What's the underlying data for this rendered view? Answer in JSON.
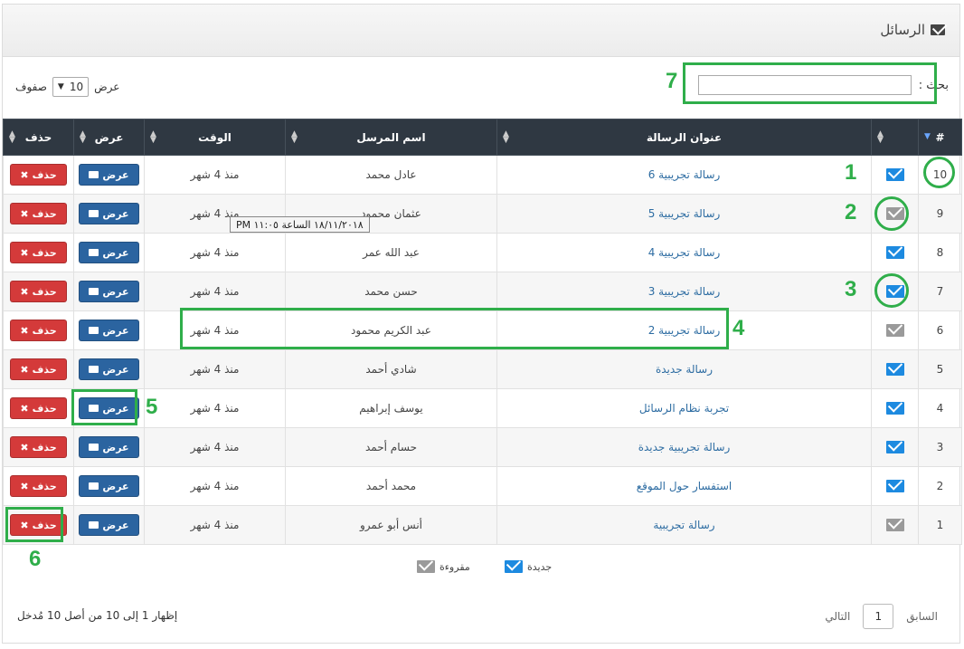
{
  "panel": {
    "title": "الرسائل",
    "icon": "envelope-icon"
  },
  "search": {
    "label": "بحث :",
    "value": ""
  },
  "length": {
    "before": "عرض",
    "value": "10",
    "after": "صفوف"
  },
  "table": {
    "columns": [
      "#",
      "",
      "عنوان الرسالة",
      "اسم المرسل",
      "الوقت",
      "عرض",
      "حذف"
    ],
    "view_label": "عرض",
    "delete_label": "حذف",
    "rows": [
      {
        "id": "10",
        "status": "new",
        "subject": "رسالة تجريبية 6",
        "sender": "عادل محمد",
        "time": "منذ 4 شهر"
      },
      {
        "id": "9",
        "status": "read",
        "subject": "رسالة تجريبية 5",
        "sender": "عثمان محمود",
        "time": "منذ 4 شهر"
      },
      {
        "id": "8",
        "status": "new",
        "subject": "رسالة تجريبية 4",
        "sender": "عبد الله عمر",
        "time": "منذ 4 شهر"
      },
      {
        "id": "7",
        "status": "new",
        "subject": "رسالة تجريبية 3",
        "sender": "حسن محمد",
        "time": "منذ 4 شهر"
      },
      {
        "id": "6",
        "status": "read",
        "subject": "رسالة تجريبية 2",
        "sender": "عبد الكريم محمود",
        "time": "منذ 4 شهر"
      },
      {
        "id": "5",
        "status": "new",
        "subject": "رسالة جديدة",
        "sender": "شادي أحمد",
        "time": "منذ 4 شهر"
      },
      {
        "id": "4",
        "status": "new",
        "subject": "تجربة نظام الرسائل",
        "sender": "يوسف إبراهيم",
        "time": "منذ 4 شهر"
      },
      {
        "id": "3",
        "status": "new",
        "subject": "رسالة تجريبية جديدة",
        "sender": "حسام أحمد",
        "time": "منذ 4 شهر"
      },
      {
        "id": "2",
        "status": "new",
        "subject": "استفسار حول الموقع",
        "sender": "محمد أحمد",
        "time": "منذ 4 شهر"
      },
      {
        "id": "1",
        "status": "read",
        "subject": "رسالة تجريبية",
        "sender": "أنس أبو عمرو",
        "time": "منذ 4 شهر"
      }
    ]
  },
  "tooltip": {
    "text": "١٨/١١/٢٠١٨ الساعة ١١:٠٥ PM"
  },
  "legend": {
    "new_label": "جديدة",
    "read_label": "مقروءة"
  },
  "footer": {
    "info": "إظهار 1 إلى 10 من أصل 10 مُدخل",
    "prev": "السابق",
    "page": "1",
    "next": "التالي"
  },
  "annotations": [
    "1",
    "2",
    "3",
    "4",
    "5",
    "6",
    "7"
  ],
  "colors": {
    "header_bg": "#2f3842",
    "new_icon": "#1d8ae0",
    "read_icon": "#9a9a9a",
    "view_btn": "#2b64a0",
    "delete_btn": "#d43a3a",
    "annotation": "#2fae4a"
  }
}
